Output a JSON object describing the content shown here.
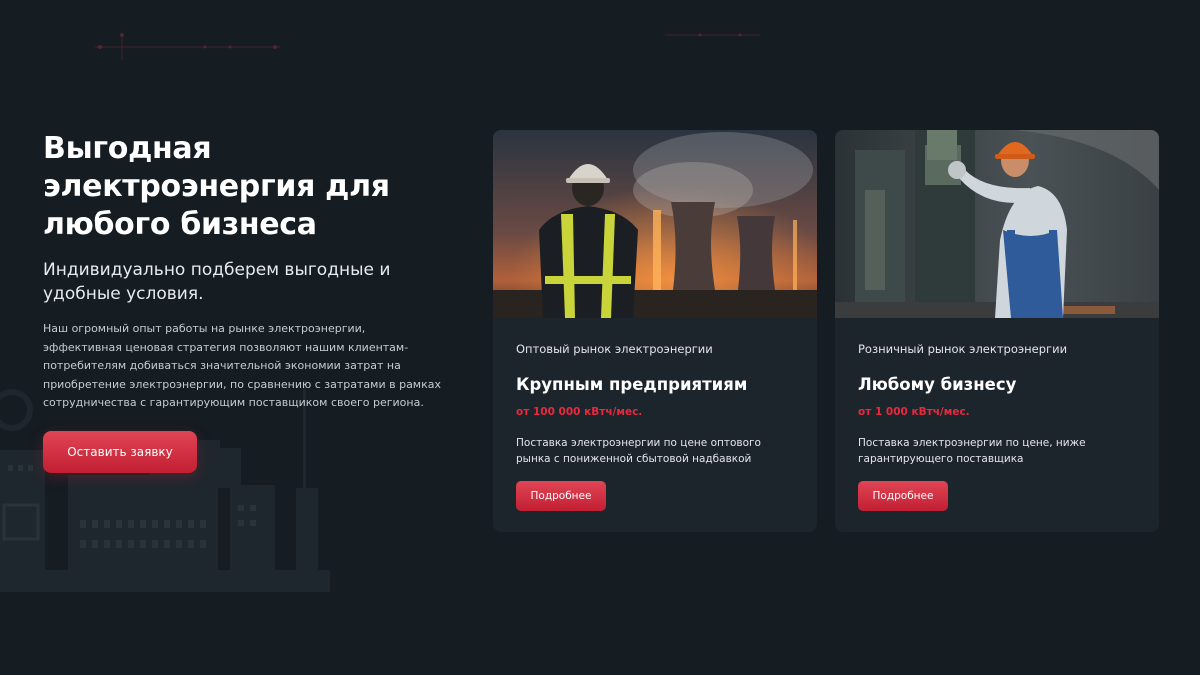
{
  "hero": {
    "title": "Выгодная электроэнергия для любого бизнеса",
    "subtitle": "Индивидуально подберем выгодные и удобные условия.",
    "description": "Наш огромный опыт работы на рынке электроэнергии, эффективная ценовая стратегия позволяют нашим клиентам-потребителям добиваться значительной экономии затрат на приобретение электроэнергии, по сравнению с затратами в рамках сотрудничества с гарантирующим поставщиком своего региона.",
    "cta_label": "Оставить заявку"
  },
  "cards": [
    {
      "image": "power-plant-worker-photo",
      "category": "Оптовый рынок электроэнергии",
      "title": "Крупным предприятиям",
      "price": "от 100 000 кВтч/мес.",
      "text": "Поставка электроэнергии по цене оптового рынка с пониженной сбытовой надбавкой",
      "button": "Подробнее"
    },
    {
      "image": "factory-worker-photo",
      "category": "Розничный рынок электроэнергии",
      "title": "Любому бизнесу",
      "price": "от 1 000 кВтч/мес.",
      "text": "Поставка электроэнергии по цене, ниже гарантирующего поставщика",
      "button": "Подробнее"
    }
  ],
  "colors": {
    "background": "#151c22",
    "card": "#1d252c",
    "accent": "#d42d40",
    "price": "#e8293e"
  }
}
